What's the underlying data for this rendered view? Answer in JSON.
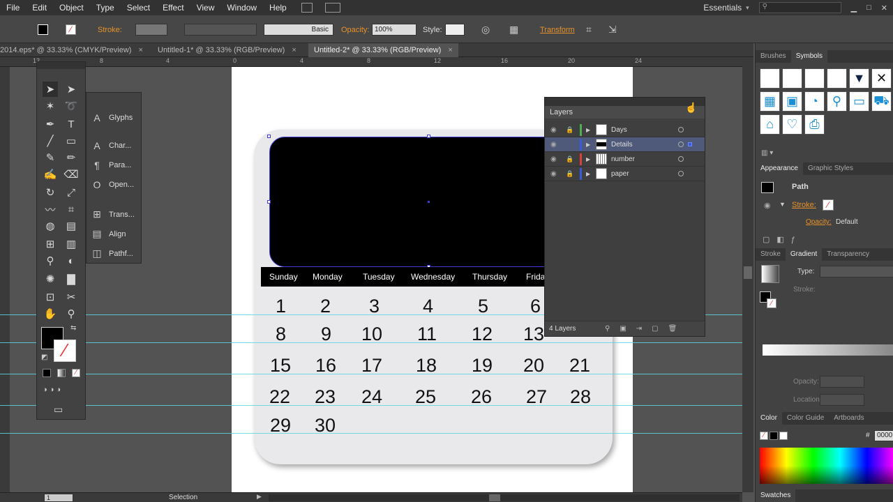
{
  "menu": [
    "File",
    "Edit",
    "Object",
    "Type",
    "Select",
    "Effect",
    "View",
    "Window",
    "Help"
  ],
  "workspace": "Essentials",
  "control": {
    "stroke_label": "Stroke:",
    "brush": "Basic",
    "opacity_label": "Opacity:",
    "opacity": "100%",
    "style_label": "Style:",
    "transform": "Transform"
  },
  "tabs": [
    {
      "label": "2014.eps* @ 33.33% (CMYK/Preview)",
      "close": "×"
    },
    {
      "label": "Untitled-1* @ 33.33% (RGB/Preview)",
      "close": "×"
    },
    {
      "label": "Untitled-2* @ 33.33% (RGB/Preview)",
      "close": "×"
    }
  ],
  "ruler": {
    "h": [
      "12",
      "8",
      "4",
      "0",
      "4",
      "8",
      "12",
      "16",
      "20",
      "24"
    ]
  },
  "side_panel": [
    "Glyphs",
    "Char...",
    "Para...",
    "Open...",
    "Trans...",
    "Align",
    "Pathf..."
  ],
  "calendar": {
    "days": [
      "Sunday",
      "Monday",
      "Tuesday",
      "Wednesday",
      "Thursday",
      "Frida"
    ],
    "rows": [
      [
        "1",
        "2",
        "3",
        "4",
        "5",
        "6"
      ],
      [
        "8",
        "9",
        "10",
        "11",
        "12",
        "13"
      ],
      [
        "15",
        "16",
        "17",
        "18",
        "19",
        "20",
        "21"
      ],
      [
        "22",
        "23",
        "24",
        "25",
        "26",
        "27",
        "28"
      ],
      [
        "29",
        "30"
      ]
    ]
  },
  "layers": {
    "title": "Layers",
    "items": [
      {
        "name": "Days",
        "color": "#4caf50",
        "locked": true
      },
      {
        "name": "Details",
        "color": "#3a5bd9",
        "locked": false,
        "selected": true
      },
      {
        "name": "number",
        "color": "#d9403a",
        "locked": true
      },
      {
        "name": "paper",
        "color": "#3a5bd9",
        "locked": true
      }
    ],
    "count": "4 Layers"
  },
  "right": {
    "tabs1": [
      "Brushes",
      "Symbols"
    ],
    "tabs2": [
      "Appearance",
      "Graphic Styles"
    ],
    "path": "Path",
    "stroke": "Stroke:",
    "opacity": "Opacity:",
    "opacity_val": "Default",
    "tabs3": [
      "Stroke",
      "Gradient",
      "Transparency"
    ],
    "type": "Type:",
    "stroke2": "Stroke:",
    "grad_opacity": "Opacity:",
    "location": "Location:",
    "tabs4": [
      "Color",
      "Color Guide",
      "Artboards"
    ],
    "hex_prefix": "#",
    "hex": "0000",
    "swatches": "Swatches"
  },
  "status": {
    "page": "1",
    "tool": "Selection"
  }
}
